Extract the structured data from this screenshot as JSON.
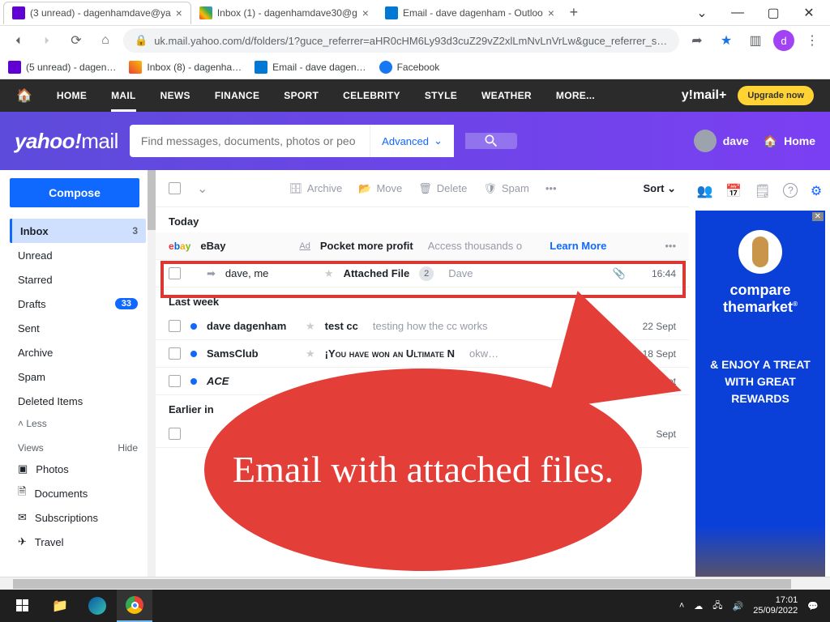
{
  "browser": {
    "tabs": [
      {
        "title": "(3 unread) - dagenhamdave@ya"
      },
      {
        "title": "Inbox (1) - dagenhamdave30@g"
      },
      {
        "title": "Email - dave dagenham - Outloo"
      }
    ],
    "url": "uk.mail.yahoo.com/d/folders/1?guce_referrer=aHR0cHM6Ly93d3cuZ29vZ2xlLmNvLnVrLw&guce_referrer_si…",
    "bookmarks": [
      {
        "title": "(5 unread) - dagen…"
      },
      {
        "title": "Inbox (8) - dagenha…"
      },
      {
        "title": "Email - dave dagen…"
      },
      {
        "title": "Facebook"
      }
    ]
  },
  "topnav": {
    "items": [
      "HOME",
      "MAIL",
      "NEWS",
      "FINANCE",
      "SPORT",
      "CELEBRITY",
      "STYLE",
      "WEATHER",
      "MORE..."
    ],
    "logo": "y!mail+",
    "upgrade": "Upgrade now"
  },
  "header": {
    "logo_a": "yahoo!",
    "logo_b": "mail",
    "search_placeholder": "Find messages, documents, photos or peo",
    "advanced": "Advanced",
    "user": "dave",
    "home": "Home"
  },
  "sidebar": {
    "compose": "Compose",
    "folders": [
      {
        "name": "Inbox",
        "count": "3",
        "active": true
      },
      {
        "name": "Unread"
      },
      {
        "name": "Starred"
      },
      {
        "name": "Drafts",
        "badge": "33"
      },
      {
        "name": "Sent"
      },
      {
        "name": "Archive"
      },
      {
        "name": "Spam"
      },
      {
        "name": "Deleted Items"
      }
    ],
    "less": "Less",
    "views_label": "Views",
    "hide": "Hide",
    "views": [
      {
        "name": "Photos",
        "icon": "▣"
      },
      {
        "name": "Documents",
        "icon": "🗎"
      },
      {
        "name": "Subscriptions",
        "icon": "✉"
      },
      {
        "name": "Travel",
        "icon": "✈"
      }
    ]
  },
  "toolbar": {
    "archive": "Archive",
    "move": "Move",
    "delete": "Delete",
    "spam": "Spam",
    "sort": "Sort"
  },
  "right_icons": {
    "contacts": "👥",
    "cal": "📅",
    "notes": "🗒",
    "help": "?",
    "gear": "⚙"
  },
  "messages": {
    "today": "Today",
    "ad": {
      "brand": "eBay",
      "label": "Ad",
      "subj": "Pocket more profit",
      "snip": "Access thousands o",
      "learn": "Learn More"
    },
    "row1": {
      "from": "dave, me",
      "subj": "Attached File",
      "count": "2",
      "preview": "Dave",
      "time": "16:44"
    },
    "lastweek": "Last week",
    "row2": {
      "from": "dave dagenham",
      "subj": "test cc",
      "snip": "testing how the cc works",
      "time": "22 Sept"
    },
    "row3": {
      "from": "SamsClub",
      "subj": "¡You have won an Ultimate N",
      "snip": "okw…",
      "time": "18 Sept"
    },
    "row4": {
      "from": "ACE",
      "time": "18 Sept"
    },
    "earlier": "Earlier in",
    "row5": {
      "time": "Sept"
    }
  },
  "ad_sidebar": {
    "brand_a": "compare",
    "brand_b": "themarket",
    "tag": "& ENJOY A TREAT WITH GREAT REWARDS"
  },
  "callout": "Email with attached files.",
  "taskbar": {
    "time": "17:01",
    "date": "25/09/2022"
  }
}
